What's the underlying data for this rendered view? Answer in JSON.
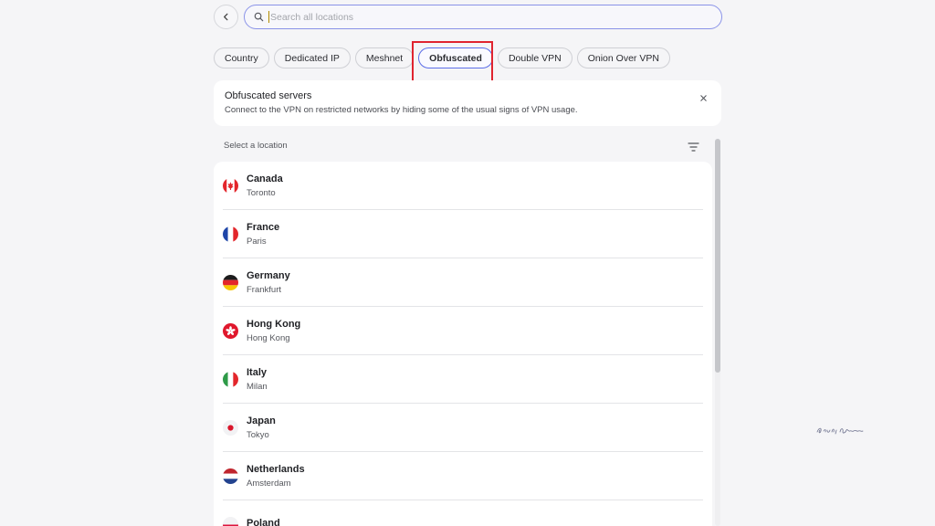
{
  "search": {
    "placeholder": "Search all locations",
    "value": ""
  },
  "filters": {
    "chips": [
      {
        "label": "Country",
        "active": false
      },
      {
        "label": "Dedicated IP",
        "active": false
      },
      {
        "label": "Meshnet",
        "active": false
      },
      {
        "label": "Obfuscated",
        "active": true
      },
      {
        "label": "Double VPN",
        "active": false
      },
      {
        "label": "Onion Over VPN",
        "active": false
      }
    ]
  },
  "info_card": {
    "title": "Obfuscated servers",
    "description": "Connect to the VPN on restricted networks by hiding some of the usual signs of VPN usage."
  },
  "list_header": {
    "label": "Select a location"
  },
  "locations": [
    {
      "country": "Canada",
      "city": "Toronto",
      "flag_icon": "canada-flag-icon"
    },
    {
      "country": "France",
      "city": "Paris",
      "flag_icon": "france-flag-icon"
    },
    {
      "country": "Germany",
      "city": "Frankfurt",
      "flag_icon": "germany-flag-icon"
    },
    {
      "country": "Hong Kong",
      "city": "Hong Kong",
      "flag_icon": "hong-kong-flag-icon"
    },
    {
      "country": "Italy",
      "city": "Milan",
      "flag_icon": "italy-flag-icon"
    },
    {
      "country": "Japan",
      "city": "Tokyo",
      "flag_icon": "japan-flag-icon"
    },
    {
      "country": "Netherlands",
      "city": "Amsterdam",
      "flag_icon": "netherlands-flag-icon"
    },
    {
      "country": "Poland",
      "city": "",
      "flag_icon": "poland-flag-icon"
    }
  ],
  "colors": {
    "accent": "#5c6ee8",
    "highlight_annotation": "#e0242f"
  },
  "watermark": {
    "text": "Eynat Adwani"
  }
}
